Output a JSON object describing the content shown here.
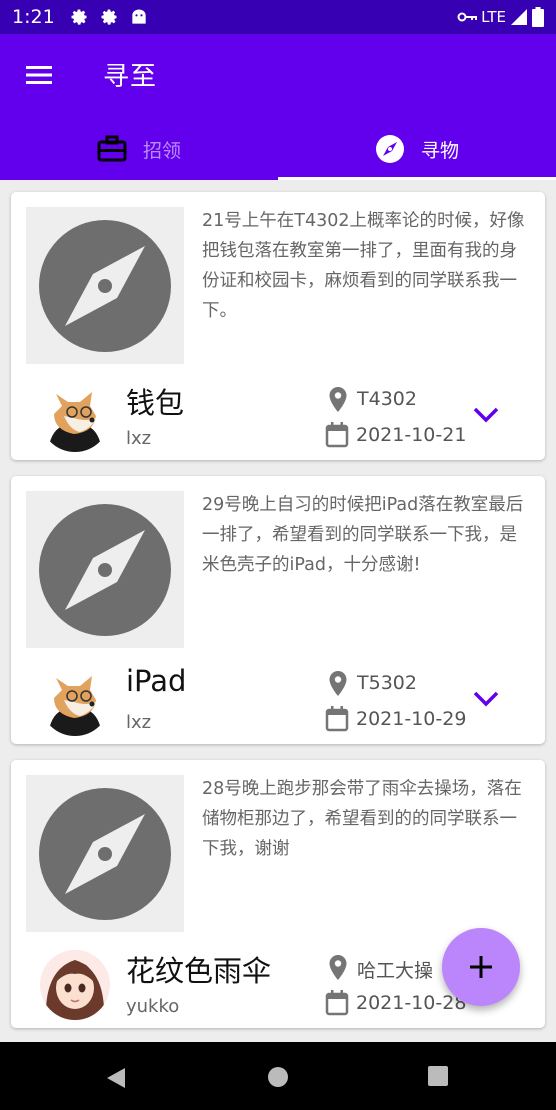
{
  "status_bar": {
    "time": "1:21",
    "network": "LTE",
    "icons": [
      "gear-icon",
      "gear-icon",
      "android-icon",
      "key-icon",
      "signal-icon",
      "battery-icon"
    ]
  },
  "app_bar": {
    "title": "寻至",
    "menu_icon": "menu-icon"
  },
  "tabs": [
    {
      "label": "招领",
      "icon": "briefcase-icon",
      "selected": false
    },
    {
      "label": "寻物",
      "icon": "compass-icon",
      "selected": true
    }
  ],
  "items": [
    {
      "description": "21号上午在T4302上概率论的时候，好像把钱包落在教室第一排了，里面有我的身份证和校园卡，麻烦看到的同学联系我一下。",
      "name": "钱包",
      "user": "lxz",
      "location": "T4302",
      "date": "2021-10-21",
      "avatar": "shiba-dog"
    },
    {
      "description": "29号晚上自习的时候把iPad落在教室最后一排了，希望看到的同学联系一下我，是米色壳子的iPad，十分感谢!",
      "name": "iPad",
      "user": "lxz",
      "location": "T5302",
      "date": "2021-10-29",
      "avatar": "shiba-dog"
    },
    {
      "description": "28号晚上跑步那会带了雨伞去操场，落在储物柜那边了，希望看到的的同学联系一下我，谢谢",
      "name": "花纹色雨伞",
      "user": "yukko",
      "location": "哈工大操",
      "date": "2021-10-28",
      "avatar": "anime-girl"
    }
  ],
  "colors": {
    "status_bar": "#3700b3",
    "primary": "#6200ee",
    "fab": "#bb86fc"
  }
}
